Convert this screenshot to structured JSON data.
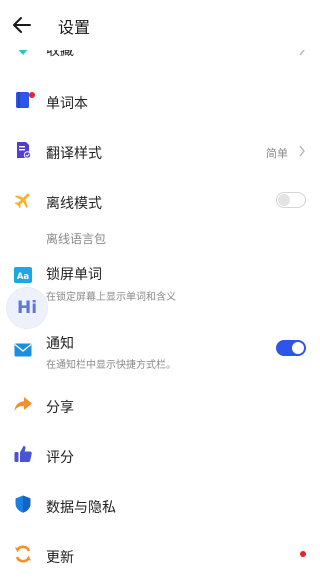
{
  "header": {
    "title": "设置"
  },
  "items": {
    "favorites": {
      "label": "收藏"
    },
    "vocab": {
      "label": "单词本"
    },
    "translate_style": {
      "label": "翻译样式",
      "value": "简单"
    },
    "offline": {
      "label": "离线模式",
      "toggle": "off"
    },
    "offline_pack": {
      "label": "离线语言包"
    },
    "lockscreen": {
      "label": "锁屏单词",
      "sub": "在锁定屏幕上显示单词和含义"
    },
    "notification": {
      "label": "通知",
      "sub": "在通知栏中显示快捷方式栏。",
      "toggle": "on"
    },
    "share": {
      "label": "分享"
    },
    "rate": {
      "label": "评分"
    },
    "privacy": {
      "label": "数据与隐私"
    },
    "update": {
      "label": "更新"
    }
  },
  "floating": {
    "label": "Hi"
  },
  "colors": {
    "accent": "#2f55e8",
    "badge": "#e6232d"
  }
}
